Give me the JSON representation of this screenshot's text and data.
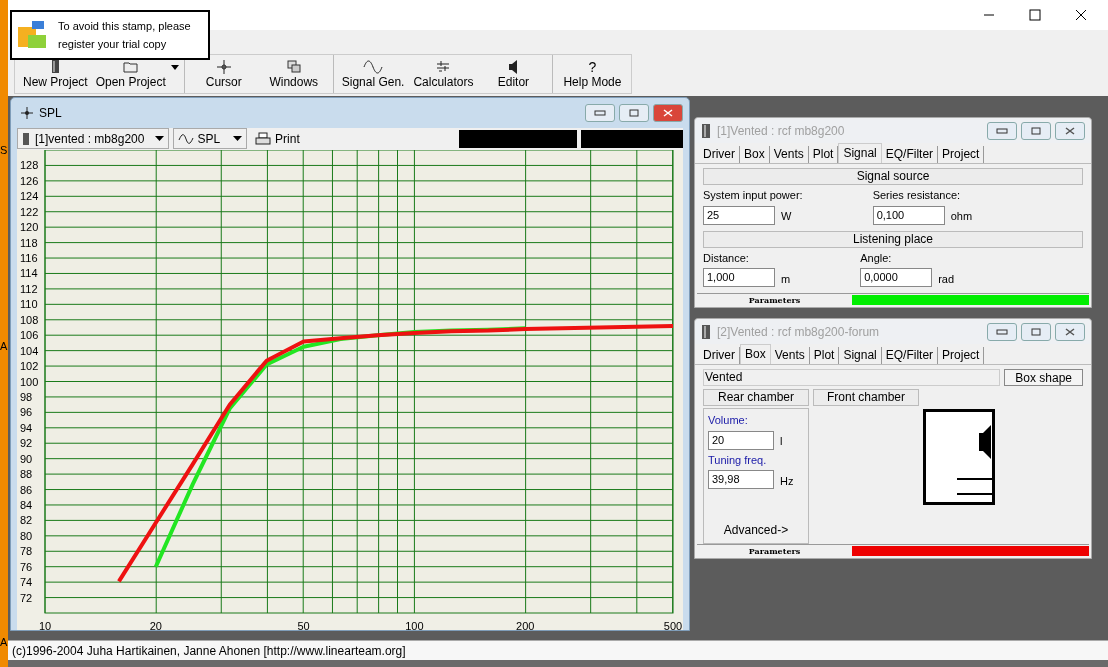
{
  "desktop_letters": [
    "S",
    "A",
    "A"
  ],
  "stamp": {
    "lines": [
      "To avoid this stamp, please",
      "register your trial copy"
    ]
  },
  "toolbar": [
    [
      {
        "kind": "new",
        "label": "New Project"
      },
      {
        "kind": "open",
        "label": "Open Project",
        "menu": true
      }
    ],
    [
      {
        "kind": "cursor",
        "label": "Cursor"
      },
      {
        "kind": "windows",
        "label": "Windows"
      }
    ],
    [
      {
        "kind": "signal",
        "label": "Signal Gen."
      },
      {
        "kind": "calc",
        "label": "Calculators"
      },
      {
        "kind": "editor",
        "label": "Editor"
      }
    ],
    [
      {
        "kind": "help",
        "label": "Help Mode",
        "glyph": "?"
      }
    ]
  ],
  "spl_window": {
    "title": "SPL",
    "selector": "[1]vented : mb8g200",
    "view": "SPL",
    "print": "Print",
    "chart_data": {
      "type": "line",
      "grid": true,
      "categories": [
        "10",
        null,
        null,
        "20",
        null,
        null,
        null,
        "50",
        null,
        null,
        "100",
        null,
        null,
        "200",
        null,
        null,
        null,
        "500"
      ],
      "ylim": [
        70,
        130
      ],
      "yticks": [
        72,
        74,
        76,
        78,
        80,
        82,
        84,
        86,
        88,
        90,
        92,
        94,
        96,
        98,
        100,
        102,
        104,
        106,
        108,
        110,
        112,
        114,
        116,
        118,
        120,
        122,
        124,
        126,
        128
      ],
      "series": [
        {
          "color": "#22e622",
          "values": [
            null,
            null,
            null,
            76,
            86.7,
            96.5,
            102.2,
            104.5,
            105.5,
            106,
            106.4,
            106.6,
            106.7,
            106.9,
            null,
            null,
            null,
            null
          ]
        },
        {
          "color": "#ee1111",
          "values": [
            null,
            null,
            74.1,
            81.7,
            89.3,
            97,
            102.7,
            105.2,
            105.6,
            106,
            106.3,
            106.5,
            106.6,
            106.8,
            106.9,
            107,
            107.1,
            107.2
          ]
        }
      ]
    }
  },
  "panels": [
    {
      "kind": "signal",
      "title": "[1]Vented : rcf mb8g200",
      "tabs": [
        {
          "label": "Driver",
          "selected": false
        },
        {
          "label": "Box",
          "selected": false
        },
        {
          "label": "Vents",
          "selected": false
        },
        {
          "label": "Plot",
          "selected": false
        },
        {
          "label": "Signal",
          "selected": true
        },
        {
          "label": "EQ/Filter",
          "selected": false
        },
        {
          "label": "Project",
          "selected": false
        }
      ],
      "sections": [
        {
          "heading": "Signal source",
          "fields": [
            {
              "label": "System input power:",
              "value": "25",
              "unit": "W"
            },
            {
              "label": "Series resistance:",
              "value": "0,100",
              "unit": "ohm"
            }
          ]
        },
        {
          "heading": "Listening place",
          "fields": [
            {
              "label": "Distance:",
              "value": "1,000",
              "unit": "m"
            },
            {
              "label": "Angle:",
              "value": "0,0000",
              "unit": "rad"
            }
          ]
        }
      ],
      "status": {
        "label": "Parameters",
        "color": "#00ee00"
      }
    },
    {
      "kind": "box",
      "title": "[2]Vented : rcf mb8g200-forum",
      "tabs": [
        {
          "label": "Driver",
          "selected": false
        },
        {
          "label": "Box",
          "selected": true
        },
        {
          "label": "Vents",
          "selected": false
        },
        {
          "label": "Plot",
          "selected": false
        },
        {
          "label": "Signal",
          "selected": false
        },
        {
          "label": "EQ/Filter",
          "selected": false
        },
        {
          "label": "Project",
          "selected": false
        }
      ],
      "box_type": "Vented",
      "box_shape": "Box shape",
      "chambers": [
        "Rear chamber",
        "Front chamber"
      ],
      "fields": [
        {
          "label": "Volume:",
          "value": "20",
          "unit": "l"
        },
        {
          "label": "Tuning freq.",
          "value": "39,98",
          "unit": "Hz"
        }
      ],
      "advanced": "Advanced->",
      "status": {
        "label": "Parameters",
        "color": "#ee0000"
      }
    }
  ],
  "status_bar": {
    "text": "(c)1996-2004 Juha Hartikainen, Janne Ahonen [http://www.linearteam.org]"
  }
}
